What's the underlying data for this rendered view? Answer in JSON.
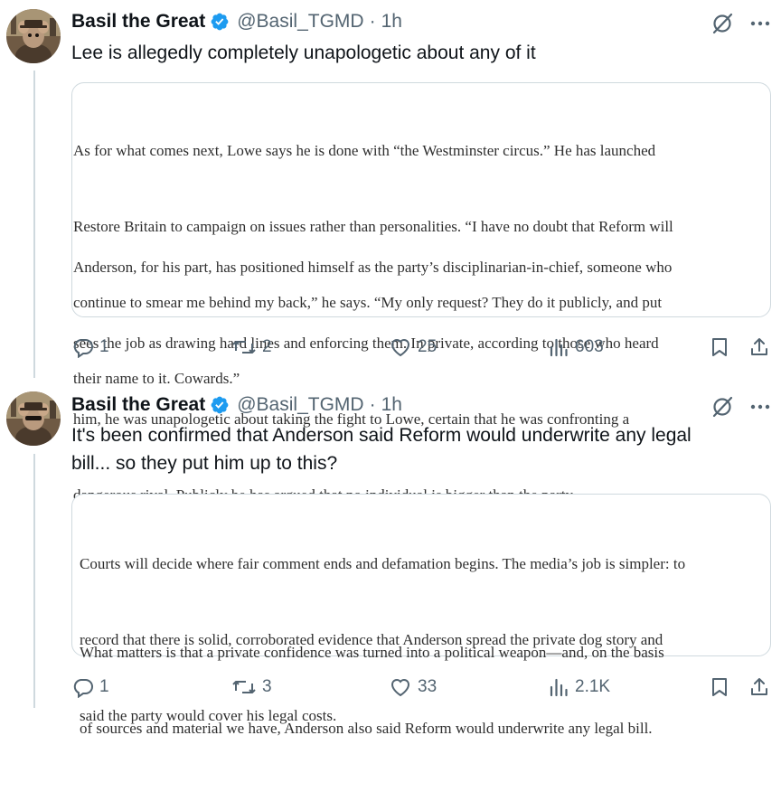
{
  "tweets": [
    {
      "author_name": "Basil the Great",
      "handle": "@Basil_TGMD",
      "separator": "·",
      "time": "1h",
      "text_lines": [
        "Lee is allegedly completely unapologetic about any of it"
      ],
      "quote": {
        "paragraphs": [
          [
            "As for what comes next, Lowe says he is done with “the Westminster circus.” He has launched",
            "Restore Britain to campaign on issues rather than personalities. “I have no doubt that Reform will",
            "continue to smear me behind my back,” he says. “My only request? They do it publicly, and put",
            "their name to it. Cowards.”"
          ],
          [
            "Anderson, for his part, has positioned himself as the party’s disciplinarian-in-chief, someone who",
            "sees the job as drawing hard lines and enforcing them. In private, according to those who heard",
            "him, he was unapologetic about taking the fight to Lowe, certain that he was confronting a",
            "dangerous rival. Publicly he has argued that no individual is bigger than the party."
          ]
        ]
      },
      "actions": {
        "replies": "1",
        "reposts": "2",
        "likes": "25",
        "views": "603"
      }
    },
    {
      "author_name": "Basil the Great",
      "handle": "@Basil_TGMD",
      "separator": "·",
      "time": "1h",
      "text_lines": [
        "It's been confirmed that Anderson said Reform would underwrite any legal",
        "bill... so they put him up to this?"
      ],
      "quote": {
        "paragraphs": [
          [
            "Courts will decide where fair comment ends and defamation begins. The media’s job is simpler: to",
            "record that there is solid, corroborated evidence that Anderson spread the private dog story and",
            "said the party would cover his legal costs."
          ],
          [
            "What matters is that a private confidence was turned into a political weapon—and, on the basis",
            "of sources and material we have, Anderson also said Reform would underwrite any legal bill."
          ]
        ]
      },
      "actions": {
        "replies": "1",
        "reposts": "3",
        "likes": "33",
        "views": "2.1K"
      }
    }
  ],
  "icons": {
    "verified": "verified-badge-icon",
    "grok": "grok-icon",
    "more": "more-icon",
    "reply": "reply-icon",
    "repost": "repost-icon",
    "like": "like-icon",
    "views": "views-icon",
    "bookmark": "bookmark-icon",
    "share": "share-icon"
  },
  "colors": {
    "verified": "#1d9bf0",
    "secondary_text": "#536471",
    "border": "#cfd9de"
  }
}
